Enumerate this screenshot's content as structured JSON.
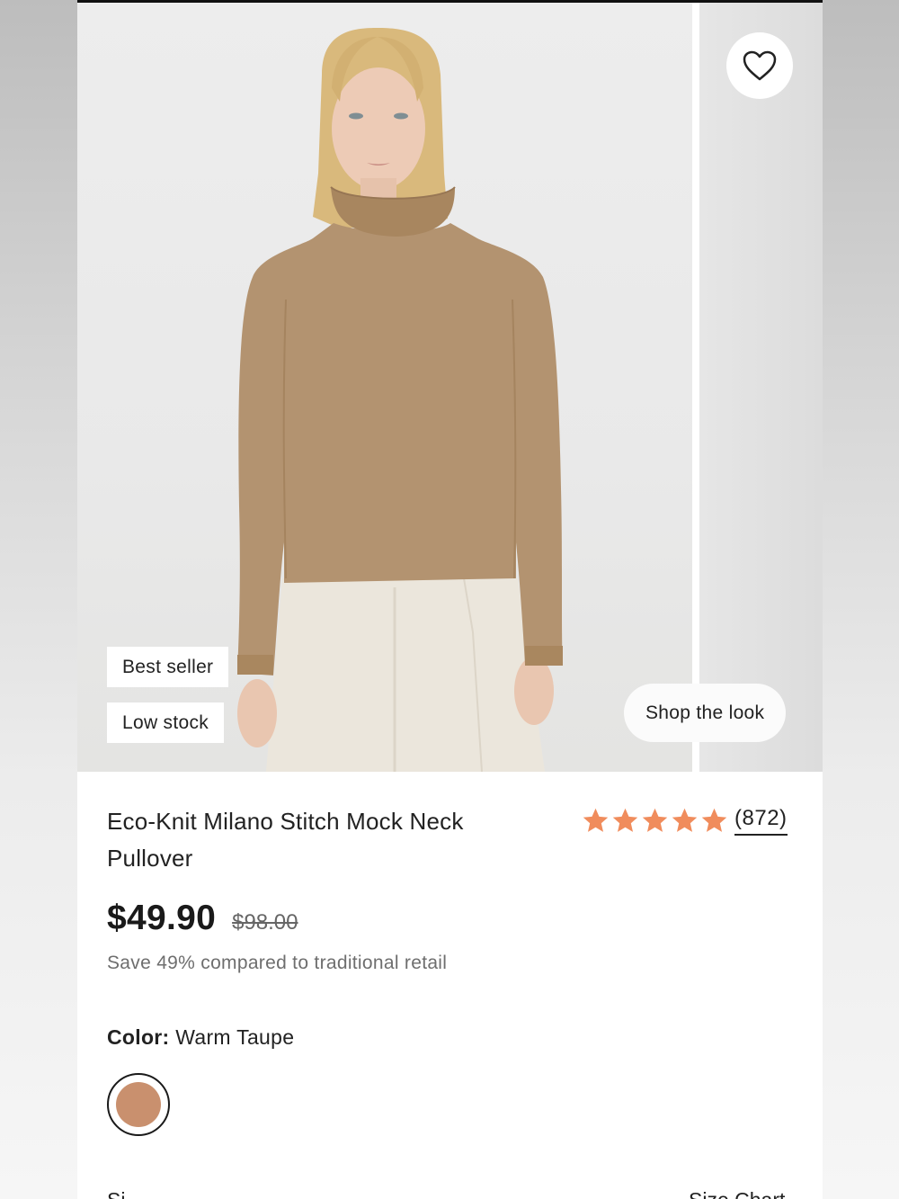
{
  "product": {
    "title": "Eco-Knit Milano Stitch Mock Neck Pullover",
    "price": "$49.90",
    "compare_price": "$98.00",
    "savings_text": "Save 49% compared to traditional retail",
    "rating": 5,
    "review_count": "(872)",
    "badges": [
      "Best seller",
      "Low stock"
    ]
  },
  "gallery": {
    "shop_the_look_label": "Shop the look",
    "favorite_icon": "heart-outline-icon"
  },
  "color": {
    "label": "Color:",
    "value": "Warm Taupe",
    "swatch_hex": "#C9906E"
  },
  "size": {
    "label": "Si",
    "chart_link": "Size Chart"
  },
  "colors": {
    "star": "#F08C5C",
    "text": "#222222",
    "muted": "#6E6E6E"
  }
}
